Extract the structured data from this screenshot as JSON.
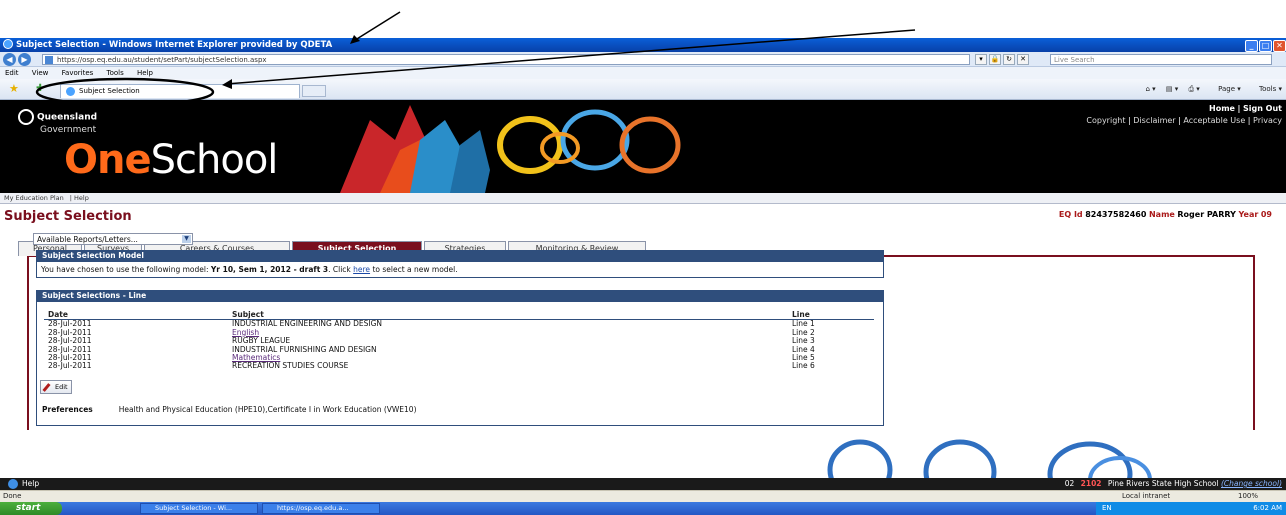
{
  "window": {
    "title": "Subject Selection - Windows Internet Explorer provided by QDETA",
    "address": "https://osp.eq.edu.au/student/setPart/subjectSelection.aspx",
    "live_search_placeholder": "Live Search",
    "min_glyph": "_",
    "max_glyph": "□",
    "close_glyph": "✕"
  },
  "menu": [
    "Edit",
    "View",
    "Favorites",
    "Tools",
    "Help"
  ],
  "ie_tab": {
    "label": "Subject Selection"
  },
  "command_bar": {
    "page": "Page",
    "tools": "Tools"
  },
  "header": {
    "gov_name": "Queensland",
    "gov_sub": "Government",
    "brand_one": "One",
    "brand_school": "School",
    "home": "Home",
    "sign_out": "Sign Out",
    "links": [
      "Copyright",
      "Disclaimer",
      "Acceptable Use",
      "Privacy"
    ]
  },
  "nav": [
    "My Education Plan",
    "Help"
  ],
  "page": {
    "title": "Subject Selection",
    "id_label": "EQ Id",
    "id_value": "82437582460",
    "name_label": "Name",
    "name_value": "Roger PARRY",
    "year_label": "Year",
    "year_value": "09"
  },
  "tabs": [
    "Personal",
    "Surveys",
    "Careers & Courses",
    "Subject Selection",
    "Strategies",
    "Monitoring & Review"
  ],
  "active_tab": "Subject Selection",
  "reports_select": "Available Reports/Letters...",
  "model_panel": {
    "heading": "Subject Selection Model",
    "text_before": "You have chosen to use the following model:",
    "model": "Yr 10, Sem 1, 2012 - draft 3",
    "text_mid": ". Click",
    "link": "here",
    "text_after": "to select a new model."
  },
  "selections_panel": {
    "heading": "Subject Selections - Line",
    "columns": [
      "Date",
      "Subject",
      "Line"
    ],
    "rows": [
      {
        "date": "28-Jul-2011",
        "subject": "INDUSTRIAL ENGINEERING AND DESIGN",
        "line": "Line 1",
        "link": false
      },
      {
        "date": "28-Jul-2011",
        "subject": "English",
        "line": "Line 2",
        "link": true
      },
      {
        "date": "28-Jul-2011",
        "subject": "RUGBY LEAGUE",
        "line": "Line 3",
        "link": false
      },
      {
        "date": "28-Jul-2011",
        "subject": "INDUSTRIAL FURNISHING AND DESIGN",
        "line": "Line 4",
        "link": false
      },
      {
        "date": "28-Jul-2011",
        "subject": "Mathematics",
        "line": "Line 5",
        "link": true
      },
      {
        "date": "28-Jul-2011",
        "subject": "RECREATION STUDIES COURSE",
        "line": "Line 6",
        "link": false
      }
    ],
    "edit_label": "Edit",
    "preferences_label": "Preferences",
    "preferences_value": "Health and Physical Education (HPE10),Certificate I in Work Education (VWE10)"
  },
  "footer": {
    "help": "Help",
    "code1": "02",
    "code2": "2102",
    "school": "Pine Rivers State High School",
    "change_school": "(Change school)"
  },
  "status": {
    "left": "Done",
    "zone": "Local intranet",
    "zoom": "100%"
  },
  "taskbar": {
    "start": "start",
    "tasks": [
      "Subject Selection - Wi...",
      "https://osp.eq.edu.a..."
    ],
    "lang": "EN",
    "clock": "6:02 AM"
  },
  "colors": {
    "brand_maroon": "#7a0f1e",
    "panel_blue": "#2f4e7c",
    "oneschool_orange": "#ff6a1a"
  }
}
